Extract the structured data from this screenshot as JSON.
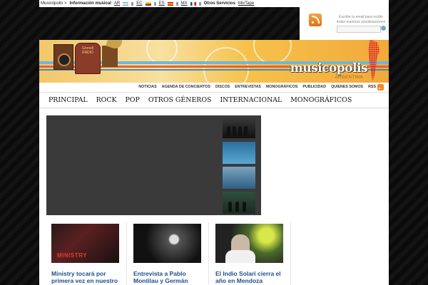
{
  "topbar": {
    "site": "Musicópolis >",
    "info": "Información musical",
    "countries": [
      "AR",
      "EC",
      "ES",
      "MX"
    ],
    "otros": "Otros Servicios",
    "mixtape": "MixTape"
  },
  "subscribe": {
    "text": "Escribe tu email para recibir todas nuestras actualizaciones"
  },
  "banner": {
    "logo": "musicopolis",
    "logo_sub": "ARGENTINA",
    "jukebox_label": "Gronell RADIO"
  },
  "subnav": [
    "NOTICIAS",
    "AGENDA DE CONCIERTOS",
    "DISCOS",
    "ENTREVISTAS",
    "MONOGRÁFICOS",
    "PUBLICIDAD",
    "QUIENES SOMOS",
    "RSS"
  ],
  "mainnav": [
    "PRINCIPAL",
    "ROCK",
    "POP",
    "OTROS GÉNEROS",
    "INTERNACIONAL",
    "MONOGRÁFICOS"
  ],
  "articles": [
    {
      "title": "Ministry tocará por primera vez en nuestro",
      "image_text": "MINISTRY"
    },
    {
      "title": "Entrevista a Pablo Montilau y Germán",
      "image_text": ""
    },
    {
      "title": "El Indio Solari cierra el año en Mendoza",
      "image_text": ""
    }
  ],
  "colors": {
    "accent": "#1e4f8c",
    "rss": "#ef8a2a"
  }
}
